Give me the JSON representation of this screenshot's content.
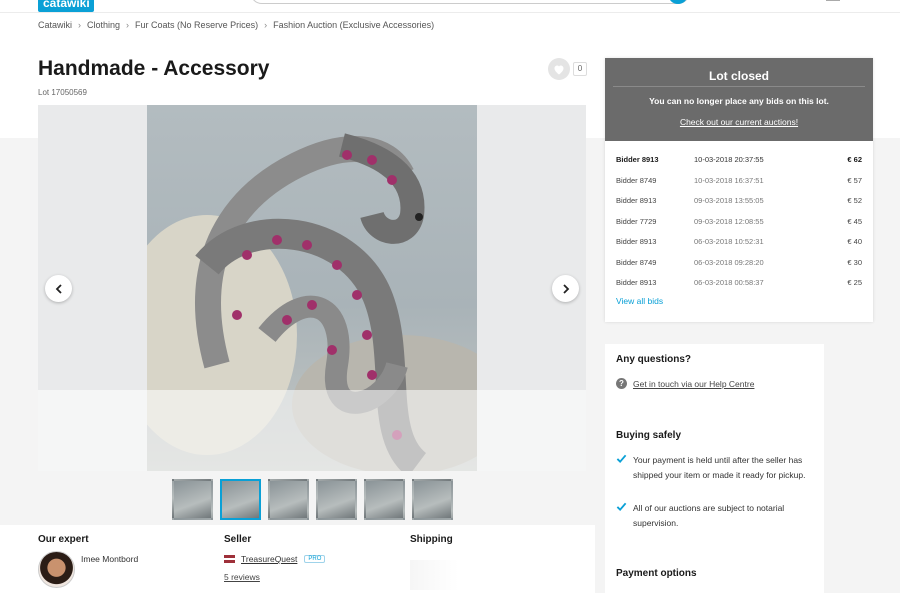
{
  "header": {
    "logo": "catawiki"
  },
  "breadcrumb": [
    "Catawiki",
    "Clothing",
    "Fur Coats (No Reserve Prices)",
    "Fashion Auction (Exclusive Accessories)"
  ],
  "lot": {
    "title": "Handmade - Accessory",
    "number": "Lot 17050569",
    "favorites_count": "0"
  },
  "gallery": {
    "thumbnail_count": 6,
    "active_thumbnail": 2
  },
  "bid_panel": {
    "status_title": "Lot closed",
    "message": "You can no longer place any bids on this lot.",
    "link": "Check out our current auctions!",
    "bids": [
      {
        "bidder": "Bidder 8913",
        "date": "10-03-2018 20:37:55",
        "amount": "€ 62"
      },
      {
        "bidder": "Bidder 8749",
        "date": "10-03-2018 16:37:51",
        "amount": "€ 57"
      },
      {
        "bidder": "Bidder 8913",
        "date": "09-03-2018 13:55:05",
        "amount": "€ 52"
      },
      {
        "bidder": "Bidder 7729",
        "date": "09-03-2018 12:08:55",
        "amount": "€ 45"
      },
      {
        "bidder": "Bidder 8913",
        "date": "06-03-2018 10:52:31",
        "amount": "€ 40"
      },
      {
        "bidder": "Bidder 8749",
        "date": "06-03-2018 09:28:20",
        "amount": "€ 30"
      },
      {
        "bidder": "Bidder 8913",
        "date": "06-03-2018 00:58:37",
        "amount": "€ 25"
      }
    ],
    "view_all": "View all bids"
  },
  "info_panel": {
    "questions_heading": "Any questions?",
    "help_link": "Get in touch via our Help Centre",
    "buying_safely_heading": "Buying safely",
    "safety_points": [
      "Your payment is held until after the seller has shipped your item or made it ready for pickup.",
      "All of our auctions are subject to notarial supervision."
    ],
    "payment_heading": "Payment options"
  },
  "bottom": {
    "expert_heading": "Our expert",
    "expert_name": "Imee Montbord",
    "seller_heading": "Seller",
    "seller_name": "TreasureQuest",
    "seller_badge": "PRO",
    "seller_reviews": "5 reviews",
    "shipping_heading": "Shipping"
  },
  "colors": {
    "accent": "#0aa0d6",
    "closed_header": "#6b6b6b"
  },
  "icons": [
    "search-icon",
    "heart-icon",
    "chevron-left-icon",
    "chevron-right-icon",
    "question-icon",
    "check-icon",
    "flag-icon"
  ]
}
